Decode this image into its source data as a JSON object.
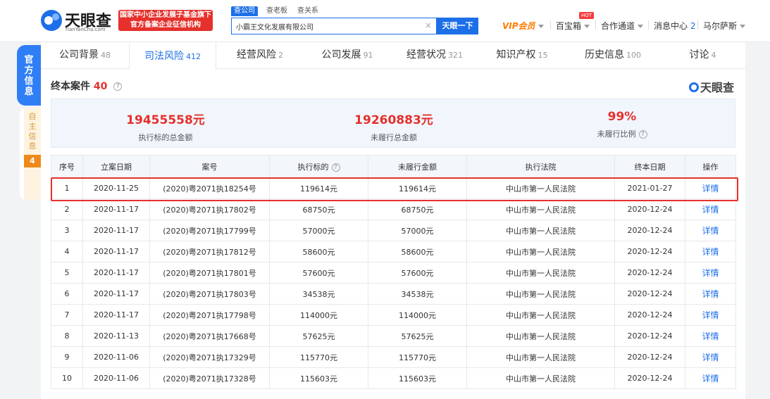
{
  "header": {
    "logo_cn": "天眼查",
    "logo_en": "TianYanCha.com",
    "badge_line1": "国家中小企业发展子基金旗下",
    "badge_line2": "官方备案企业征信机构",
    "search_tabs": [
      "查公司",
      "查老板",
      "查关系"
    ],
    "search_value": "小霸王文化发展有限公司",
    "clear": "×",
    "search_button": "天眼一下",
    "nav": {
      "vip": "VIP会员",
      "treasure": "百宝箱",
      "hot": "HOT",
      "channel": "合作通道",
      "messages": "消息中心",
      "messages_count": "2",
      "user": "马尔萨斯"
    }
  },
  "sidebar": {
    "official": "官方信息",
    "self": "自主信息",
    "self_count": "4"
  },
  "tabs": [
    {
      "label": "公司背景",
      "count": "48"
    },
    {
      "label": "司法风险",
      "count": "412"
    },
    {
      "label": "经营风险",
      "count": "2"
    },
    {
      "label": "公司发展",
      "count": "91"
    },
    {
      "label": "经营状况",
      "count": "321"
    },
    {
      "label": "知识产权",
      "count": "15"
    },
    {
      "label": "历史信息",
      "count": "100"
    },
    {
      "label": "讨论",
      "count": "4"
    }
  ],
  "section": {
    "title": "终本案件",
    "count": "40",
    "watermark": "天眼查"
  },
  "summary": [
    {
      "value": "19455558元",
      "label": "执行标的总金额"
    },
    {
      "value": "19260883元",
      "label": "未履行总金额"
    },
    {
      "value": "99%",
      "label": "未履行比例"
    }
  ],
  "table": {
    "headers": [
      "序号",
      "立案日期",
      "案号",
      "执行标的",
      "未履行金额",
      "执行法院",
      "终本日期",
      "操作"
    ],
    "rows": [
      [
        "1",
        "2020-11-25",
        "(2020)粤2071执18254号",
        "119614元",
        "119614元",
        "中山市第一人民法院",
        "2021-01-27",
        "详情"
      ],
      [
        "2",
        "2020-11-17",
        "(2020)粤2071执17802号",
        "68750元",
        "68750元",
        "中山市第一人民法院",
        "2020-12-24",
        "详情"
      ],
      [
        "3",
        "2020-11-17",
        "(2020)粤2071执17799号",
        "57000元",
        "57000元",
        "中山市第一人民法院",
        "2020-12-24",
        "详情"
      ],
      [
        "4",
        "2020-11-17",
        "(2020)粤2071执17812号",
        "58600元",
        "58600元",
        "中山市第一人民法院",
        "2020-12-24",
        "详情"
      ],
      [
        "5",
        "2020-11-17",
        "(2020)粤2071执17801号",
        "57600元",
        "57600元",
        "中山市第一人民法院",
        "2020-12-24",
        "详情"
      ],
      [
        "6",
        "2020-11-17",
        "(2020)粤2071执17803号",
        "34538元",
        "34538元",
        "中山市第一人民法院",
        "2020-12-24",
        "详情"
      ],
      [
        "7",
        "2020-11-17",
        "(2020)粤2071执17798号",
        "114000元",
        "114000元",
        "中山市第一人民法院",
        "2020-12-24",
        "详情"
      ],
      [
        "8",
        "2020-11-13",
        "(2020)粤2071执17668号",
        "57625元",
        "57625元",
        "中山市第一人民法院",
        "2020-12-24",
        "详情"
      ],
      [
        "9",
        "2020-11-06",
        "(2020)粤2071执17329号",
        "115770元",
        "115770元",
        "中山市第一人民法院",
        "2020-12-24",
        "详情"
      ],
      [
        "10",
        "2020-11-06",
        "(2020)粤2071执17328号",
        "115603元",
        "115603元",
        "中山市第一人民法院",
        "2020-12-24",
        "详情"
      ]
    ]
  },
  "colors": {
    "brand_blue": "#1d6fe8",
    "highlight_red": "#e5302b",
    "vip_orange": "#ff7a00"
  }
}
